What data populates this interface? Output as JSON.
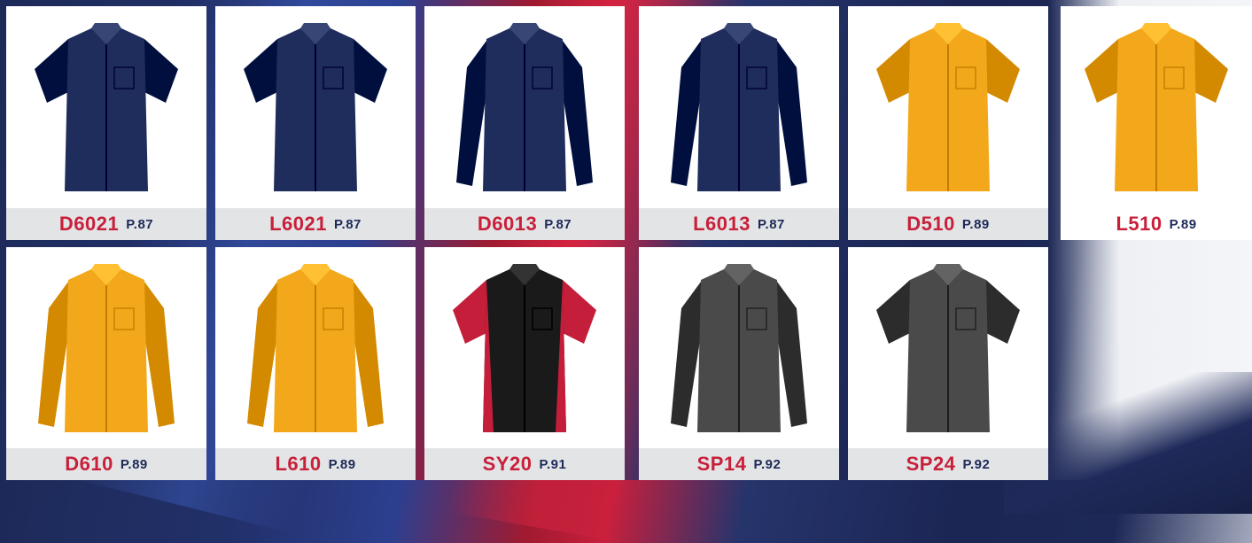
{
  "products": [
    {
      "code": "D6021",
      "page": "P.87",
      "color": "#1f2d5c",
      "style": "short"
    },
    {
      "code": "L6021",
      "page": "P.87",
      "color": "#1f2d5c",
      "style": "short"
    },
    {
      "code": "D6013",
      "page": "P.87",
      "color": "#1f2d5c",
      "style": "long"
    },
    {
      "code": "L6013",
      "page": "P.87",
      "color": "#1f2d5c",
      "style": "long"
    },
    {
      "code": "D510",
      "page": "P.89",
      "color": "#f2a81a",
      "style": "short"
    },
    {
      "code": "L510",
      "page": "P.89",
      "color": "#f2a81a",
      "style": "short"
    },
    {
      "code": "D610",
      "page": "P.89",
      "color": "#f2a81a",
      "style": "long"
    },
    {
      "code": "L610",
      "page": "P.89",
      "color": "#f2a81a",
      "style": "long"
    },
    {
      "code": "SY20",
      "page": "P.91",
      "color": "#1a1a1a",
      "accent": "#c41e3a",
      "style": "twotone"
    },
    {
      "code": "SP14",
      "page": "P.92",
      "color": "#4a4a4a",
      "style": "long"
    },
    {
      "code": "SP24",
      "page": "P.92",
      "color": "#4a4a4a",
      "style": "short"
    }
  ]
}
